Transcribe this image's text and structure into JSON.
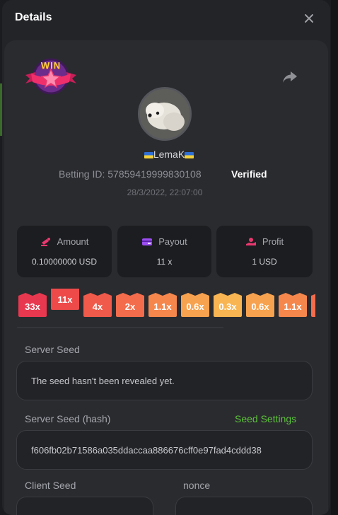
{
  "modal": {
    "title": "Details"
  },
  "icons": {
    "close": "close-icon",
    "share": "share-icon",
    "win": "win-badge-icon"
  },
  "badge": {
    "text": "WIN"
  },
  "player": {
    "name": "LemaK"
  },
  "bet": {
    "betting_id_label": "Betting ID:",
    "betting_id": "57859419999830108",
    "verified": "Verified",
    "timestamp": "28/3/2022, 22:07:00"
  },
  "stats": [
    {
      "label": "Amount",
      "value": "0.10000000 USD",
      "icon": "amount-icon"
    },
    {
      "label": "Payout",
      "value": "11 x",
      "icon": "wallet-icon"
    },
    {
      "label": "Profit",
      "value": "1 USD",
      "icon": "profit-icon"
    }
  ],
  "multipliers": [
    {
      "label": "33x",
      "color": "#e8384f"
    },
    {
      "label": "11x",
      "color": "#ee4a4a",
      "active": true
    },
    {
      "label": "4x",
      "color": "#f05a4a"
    },
    {
      "label": "2x",
      "color": "#f36c4c"
    },
    {
      "label": "1.1x",
      "color": "#f5874d"
    },
    {
      "label": "0.6x",
      "color": "#f7a24f"
    },
    {
      "label": "0.3x",
      "color": "#f8b552"
    },
    {
      "label": "0.6x",
      "color": "#f7a24f"
    },
    {
      "label": "1.1x",
      "color": "#f5874d"
    },
    {
      "label": "",
      "color": "#f36c4c"
    }
  ],
  "seeds": {
    "server_label": "Server Seed",
    "server_value": "The seed hasn't been revealed yet.",
    "server_hash_label": "Server Seed (hash)",
    "seed_settings": "Seed Settings",
    "server_hash_value": "f606fb02b71586a035ddaccaa886676cff0e97fad4cddd38",
    "client_label": "Client Seed",
    "nonce_label": "nonce"
  },
  "colors": {
    "accent": "#5cc23b",
    "panel": "#2a2b2f",
    "field": "#222327"
  }
}
